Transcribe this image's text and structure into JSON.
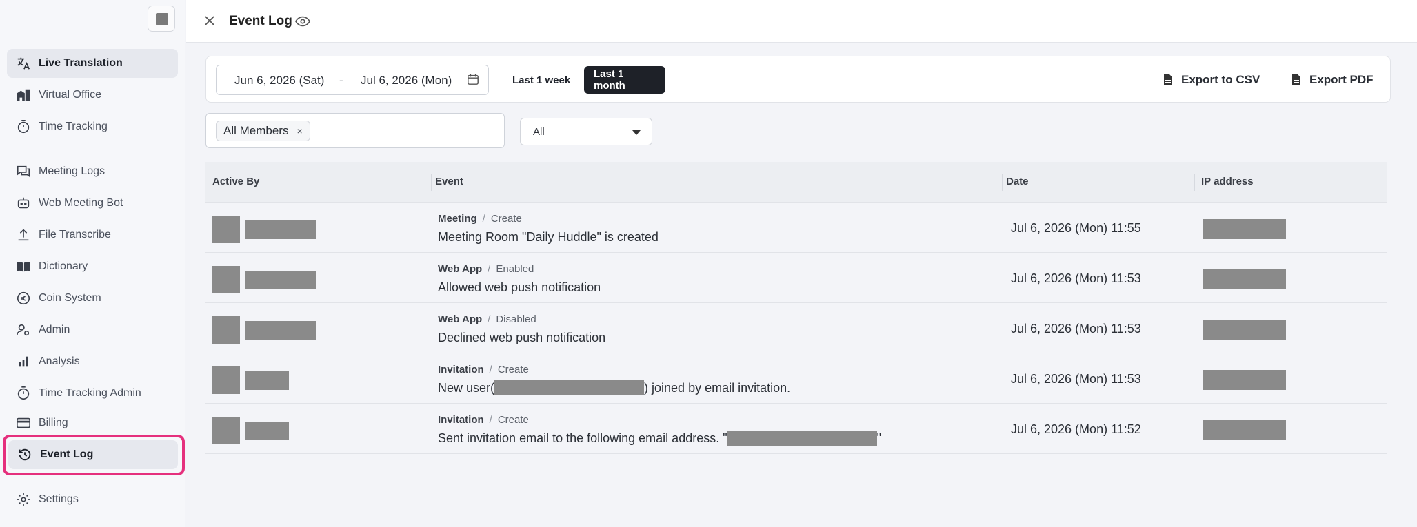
{
  "sidebar": {
    "items": [
      {
        "label": "Live Translation",
        "icon": "translate-icon"
      },
      {
        "label": "Virtual Office",
        "icon": "office-icon"
      },
      {
        "label": "Time Tracking",
        "icon": "stopwatch-icon"
      },
      {
        "label": "Meeting Logs",
        "icon": "chat-bubbles-icon"
      },
      {
        "label": "Web Meeting Bot",
        "icon": "robot-icon"
      },
      {
        "label": "File Transcribe",
        "icon": "upload-icon"
      },
      {
        "label": "Dictionary",
        "icon": "book-icon"
      },
      {
        "label": "Coin System",
        "icon": "coin-icon"
      },
      {
        "label": "Admin",
        "icon": "user-gear-icon"
      },
      {
        "label": "Analysis",
        "icon": "bar-chart-icon"
      },
      {
        "label": "Time Tracking Admin",
        "icon": "stopwatch-icon"
      },
      {
        "label": "Billing",
        "icon": "credit-card-icon"
      },
      {
        "label": "Event Log",
        "icon": "history-icon"
      },
      {
        "label": "Settings",
        "icon": "gear-icon"
      }
    ]
  },
  "header": {
    "title": "Event Log"
  },
  "filters": {
    "date_from": "Jun 6, 2026 (Sat)",
    "date_separator": "-",
    "date_to": "Jul 6, 2026 (Mon)",
    "last_week": "Last 1 week",
    "last_month": "Last 1 month",
    "export_csv": "Export to CSV",
    "export_pdf": "Export PDF",
    "member_chip": "All Members",
    "chip_remove": "×",
    "category_select": "All"
  },
  "table": {
    "headers": [
      "Active By",
      "Event",
      "Date",
      "IP address"
    ],
    "rows": [
      {
        "category": "Meeting",
        "action": "Create",
        "description": "Meeting Room \"Daily Huddle\" is created",
        "date": "Jul 6, 2026 (Mon) 11:55"
      },
      {
        "category": "Web App",
        "action": "Enabled",
        "description": "Allowed web push notification",
        "date": "Jul 6, 2026 (Mon) 11:53"
      },
      {
        "category": "Web App",
        "action": "Disabled",
        "description": "Declined web push notification",
        "date": "Jul 6, 2026 (Mon) 11:53"
      },
      {
        "category": "Invitation",
        "action": "Create",
        "description_prefix": "New user(",
        "description_suffix": ") joined by email invitation.",
        "date": "Jul 6, 2026 (Mon) 11:53"
      },
      {
        "category": "Invitation",
        "action": "Create",
        "description_prefix": "Sent invitation email to the following email address. \"",
        "description_suffix": "\"",
        "date": "Jul 6, 2026 (Mon) 11:52"
      }
    ]
  },
  "colors": {
    "highlight": "#e5307d",
    "primary_button": "#1e2128",
    "redaction": "#8a8a8a"
  }
}
